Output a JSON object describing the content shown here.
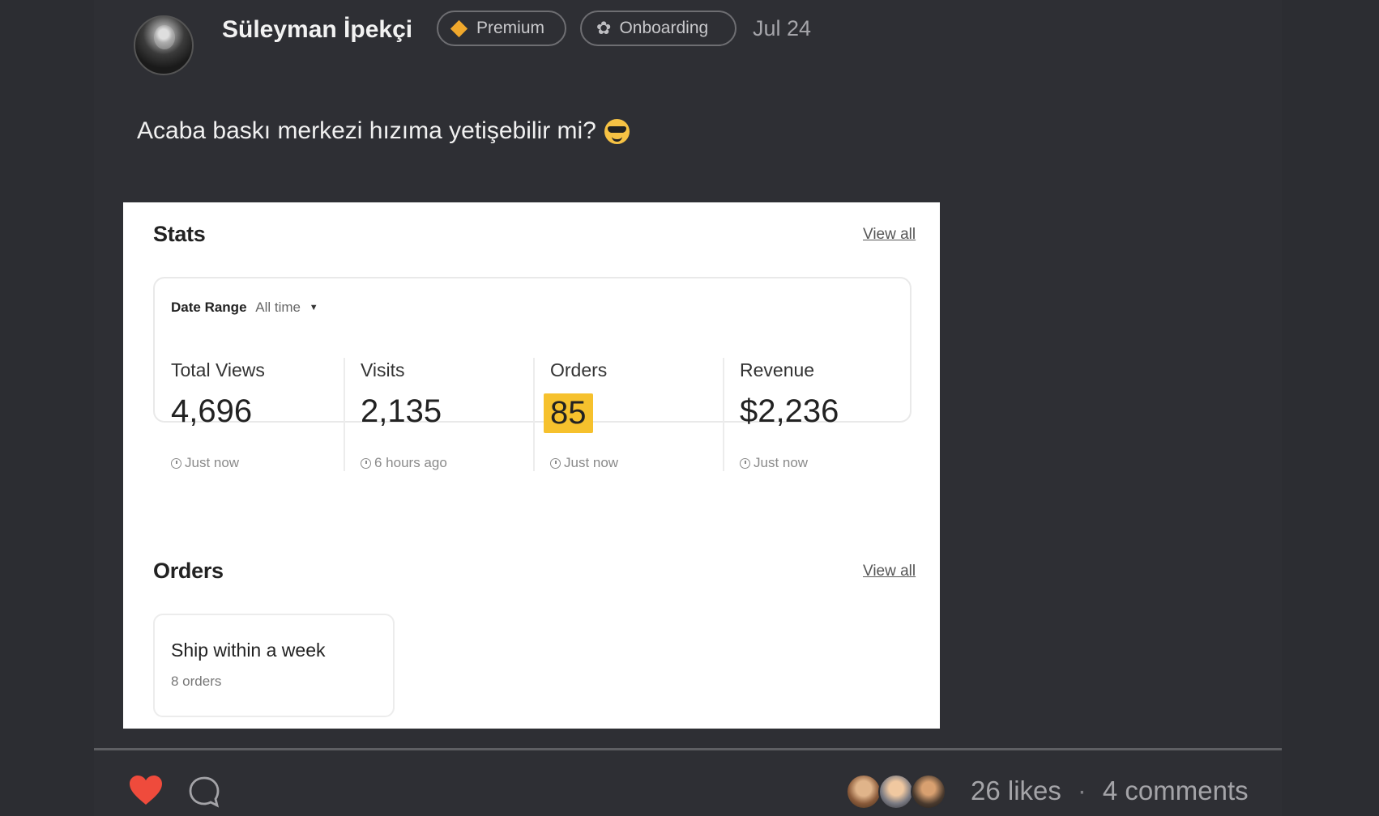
{
  "post": {
    "author": "Süleyman İpekçi",
    "badges": {
      "premium": "Premium",
      "onboarding": "Onboarding"
    },
    "date": "Jul 24",
    "text": "Acaba baskı merkezi hızıma yetişebilir mi?"
  },
  "screenshot": {
    "stats": {
      "title": "Stats",
      "view_all": "View all",
      "date_range_label": "Date Range",
      "date_range_value": "All time",
      "items": [
        {
          "label": "Total Views",
          "value": "4,696",
          "time": "Just now"
        },
        {
          "label": "Visits",
          "value": "2,135",
          "time": "6 hours ago"
        },
        {
          "label": "Orders",
          "value": "85",
          "time": "Just now"
        },
        {
          "label": "Revenue",
          "value": "$2,236",
          "time": "Just now"
        }
      ]
    },
    "orders": {
      "title": "Orders",
      "view_all": "View all",
      "card": {
        "title": "Ship within a week",
        "count": "8 orders"
      }
    }
  },
  "footer": {
    "likes": "26 likes",
    "separator": "·",
    "comments": "4 comments",
    "heart_color": "#ef4b3c"
  }
}
